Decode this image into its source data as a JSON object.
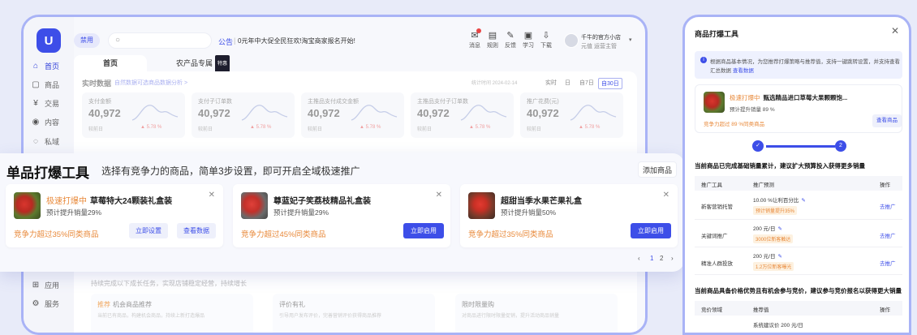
{
  "sidebar": {
    "items": [
      {
        "label": "首页",
        "icon": "home-icon",
        "glyph": "⌂"
      },
      {
        "label": "商品",
        "icon": "product-icon",
        "glyph": "▢"
      },
      {
        "label": "交易",
        "icon": "trade-icon",
        "glyph": "¥"
      },
      {
        "label": "内容",
        "icon": "content-icon",
        "glyph": "◉"
      },
      {
        "label": "私域",
        "icon": "private-icon",
        "glyph": "◌"
      },
      {
        "label": "应用",
        "icon": "apps-icon",
        "glyph": "⊞"
      },
      {
        "label": "服务",
        "icon": "service-icon",
        "glyph": "⚙"
      }
    ],
    "logo_glyph": "U"
  },
  "topbar": {
    "role": "禁用",
    "notice_label": "公告",
    "notice_text": "0元年中大促全民狂欢!淘宝商家报名开始!",
    "tools": [
      {
        "label": "消息",
        "icon": "message-icon",
        "glyph": "✉"
      },
      {
        "label": "规则",
        "icon": "rules-icon",
        "glyph": "▤"
      },
      {
        "label": "反馈",
        "icon": "feedback-icon",
        "glyph": "✎"
      },
      {
        "label": "学习",
        "icon": "learn-icon",
        "glyph": "▣"
      },
      {
        "label": "下载",
        "icon": "download-icon",
        "glyph": "⇩"
      }
    ],
    "user_name": "千牛的官方小店",
    "user_role": "元值  运营主管",
    "caret": "▾"
  },
  "tabs": [
    {
      "label": "首页"
    },
    {
      "label": "农产品专属",
      "badge": "特惠"
    }
  ],
  "realtime": {
    "title": "实时数据",
    "subtitle": "自然数据可选商品数据分析 >",
    "time": "统计时间 2024-02-14",
    "ranges": [
      "实时",
      "日",
      "自7日",
      "自30日"
    ],
    "metrics": [
      {
        "label": "支付金额",
        "value": "40,972",
        "compare": "较前日",
        "change": "▲ 5.78 %"
      },
      {
        "label": "支付子订单数",
        "value": "40,972",
        "compare": "较前日",
        "change": "▲ 5.78 %"
      },
      {
        "label": "主推品支付成交金额",
        "value": "40,972",
        "compare": "较前日",
        "change": "▲ 5.78 %"
      },
      {
        "label": "主推品支付子订单数",
        "value": "40,972",
        "compare": "较前日",
        "change": "▲ 5.78 %"
      },
      {
        "label": "推广花费(元)",
        "value": "40,972",
        "compare": "较前日",
        "change": "▲ 5.78 %"
      }
    ]
  },
  "tasks": {
    "hint": "持续完成以下成长任务，实现店铺稳定经营，持续增长",
    "cards": [
      {
        "tag": "推荐",
        "title": "机会商品推荐",
        "desc": "当前已有商品，构建机会商品，持续上新打造爆品"
      },
      {
        "title": "评价有礼",
        "desc": "引导用户发布评价，完善营销评价获得商品推荐"
      },
      {
        "title": "限时限量购",
        "desc": "对商品进行限时限量促销，提升活动商品销量"
      }
    ]
  },
  "overlay": {
    "title": "单品打爆工具",
    "subtitle": "选择有竞争力的商品，简单3步设置，即可开启全域极速推广",
    "add_button": "添加商品",
    "cards": [
      {
        "tag": "极速打爆中",
        "title": "草莓特大24颗装礼盒装",
        "predict": "预计提升销量29%",
        "competitive": "竞争力超过35%同类商品",
        "buttons": [
          "立即设置",
          "查看数据"
        ]
      },
      {
        "title": "尊蓝妃子笑荔枝精品礼盒装",
        "predict": "预计提升销量29%",
        "competitive": "竞争力超过45%同类商品",
        "buttons": [
          "立即启用"
        ]
      },
      {
        "title": "超甜当季水果芒果礼盒",
        "predict": "预计提升销量50%",
        "competitive": "竞争力超过35%同类商品",
        "buttons": [
          "立即启用"
        ]
      }
    ],
    "pager": {
      "prev": "‹",
      "pages": [
        "1",
        "2"
      ],
      "current": "1",
      "next": "›"
    }
  },
  "panel": {
    "title": "商品打爆工具",
    "info": "根据商品基本情况，为您推荐打爆策略与推荐值，支持一键跳转设置，并支持查看",
    "info_line2": "汇总数据",
    "info_link": "查看数据",
    "product": {
      "tag": "极速打爆中",
      "title": "甄选精品进口草莓大果颗颗饱...",
      "predict": "预计提升销量 89 %",
      "competitive": "竞争力超过 89 %同类商品",
      "button": "查看商品"
    },
    "steps": [
      "✓",
      "2"
    ],
    "section1": "当前商品已完成基础销量累计，建议扩大预算投入获得更多销量",
    "table1": {
      "headers": [
        "推广工具",
        "推广预测",
        "操作"
      ],
      "rows": [
        {
          "tool": "新客营销托管",
          "value": "10.00 %让利百分比",
          "boost": "预计销量提升35%",
          "action": "去推广"
        },
        {
          "tool": "关键词推广",
          "value": "200 元/日",
          "boost": "3000位新客触达",
          "action": "去推广"
        },
        {
          "tool": "精准人群投放",
          "value": "200 元/日",
          "boost": "1.2万位新客曝光",
          "action": "去推广"
        }
      ]
    },
    "section2": "当前商品具备价格优势且有机会参与竞价，建议参与竞价报名以获得更大销量",
    "table2": {
      "headers": [
        "竞价领域",
        "推荐值",
        "操作"
      ],
      "rows": [
        {
          "tool": "",
          "value": "系统建议价 200 元/日"
        }
      ]
    }
  }
}
